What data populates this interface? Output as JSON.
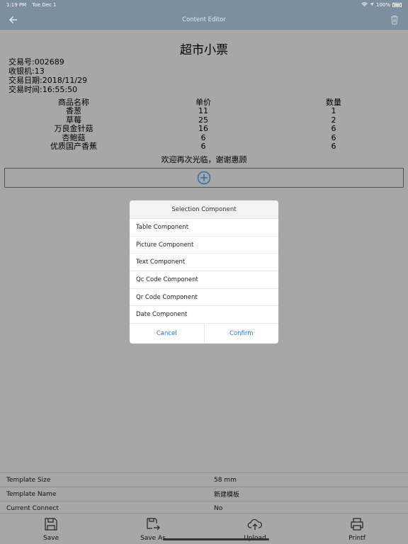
{
  "status_bar": {
    "time": "1:19 PM",
    "date": "Tue Dec 1",
    "battery": "100%"
  },
  "nav": {
    "title": "Content Editor"
  },
  "receipt": {
    "title": "超市小票",
    "info": [
      "交易号:002689",
      "收银机:13",
      "交易日期:2018/11/29",
      "交易时间:16:55:50"
    ],
    "columns": [
      "商品名称",
      "单价",
      "数量"
    ],
    "rows": [
      [
        "香葱",
        "11",
        "1"
      ],
      [
        "草莓",
        "25",
        "2"
      ],
      [
        "万良金针菇",
        "16",
        "6"
      ],
      [
        "杏鲍菇",
        "6",
        "6"
      ],
      [
        "优质国产香蕉",
        "6",
        "6"
      ]
    ],
    "footer": "欢迎再次光临，谢谢惠顾"
  },
  "dialog": {
    "title": "Selection Component",
    "items": [
      "Table Component",
      "Picture Component",
      "Text Component",
      "Qc Code Component",
      "Qr Code Component",
      "Date Component"
    ],
    "cancel": "Cancel",
    "confirm": "Confirm"
  },
  "settings": [
    {
      "label": "Template Size",
      "value": "58 mm"
    },
    {
      "label": "Template Name",
      "value": "新建模板"
    },
    {
      "label": "Current Connect",
      "value": "No"
    }
  ],
  "toolbar": {
    "save": "Save",
    "save_as": "Save As",
    "upload": "Upload",
    "print": "Printf"
  }
}
